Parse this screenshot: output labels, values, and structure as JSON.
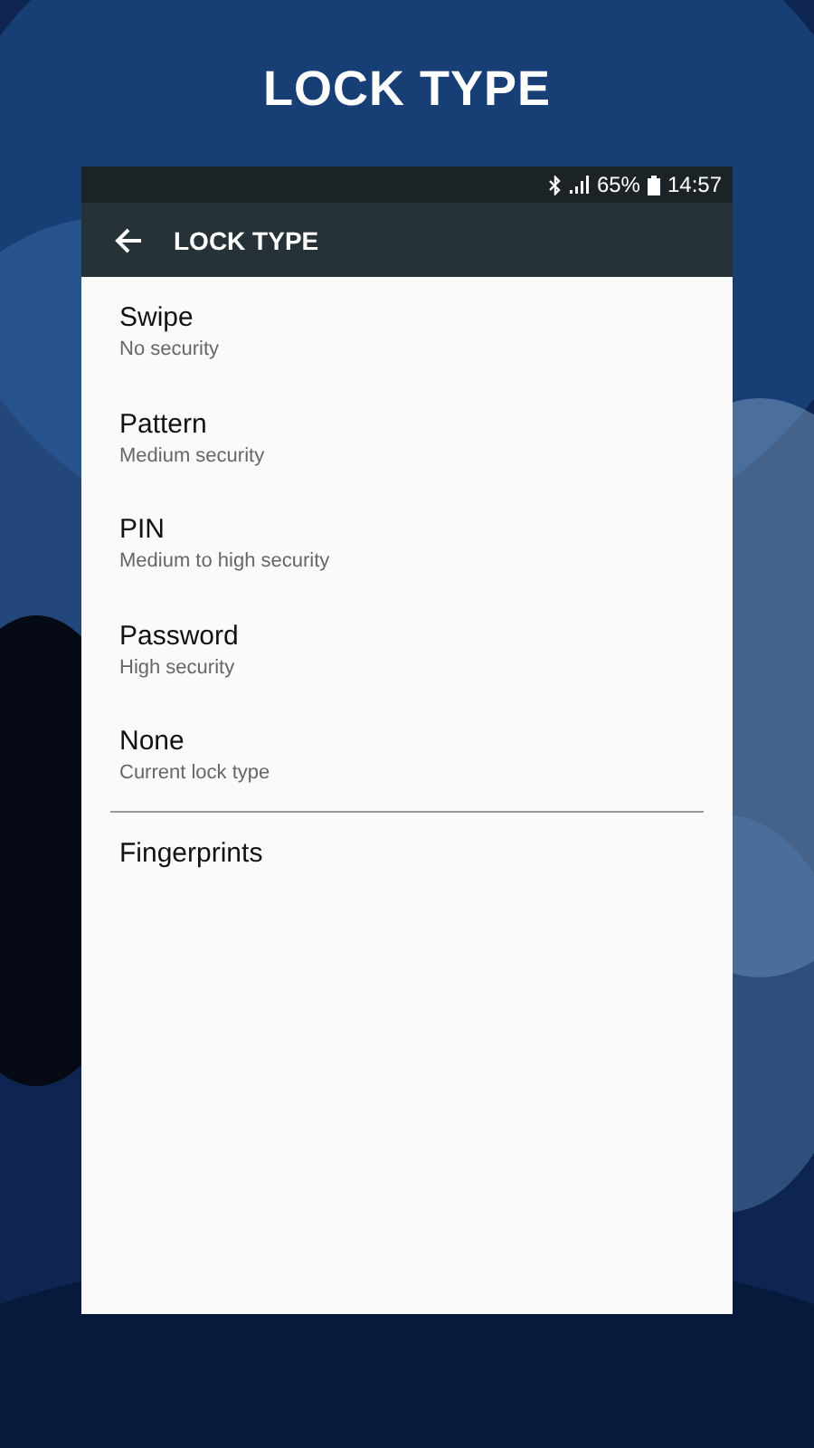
{
  "headline": "LOCK TYPE",
  "status_bar": {
    "battery": "65%",
    "time": "14:57"
  },
  "app_bar": {
    "title": "LOCK TYPE"
  },
  "options": [
    {
      "title": "Swipe",
      "subtitle": "No security"
    },
    {
      "title": "Pattern",
      "subtitle": "Medium security"
    },
    {
      "title": "PIN",
      "subtitle": "Medium to high security"
    },
    {
      "title": "Password",
      "subtitle": "High security"
    },
    {
      "title": "None",
      "subtitle": "Current lock type"
    }
  ],
  "extra": {
    "title": "Fingerprints"
  }
}
